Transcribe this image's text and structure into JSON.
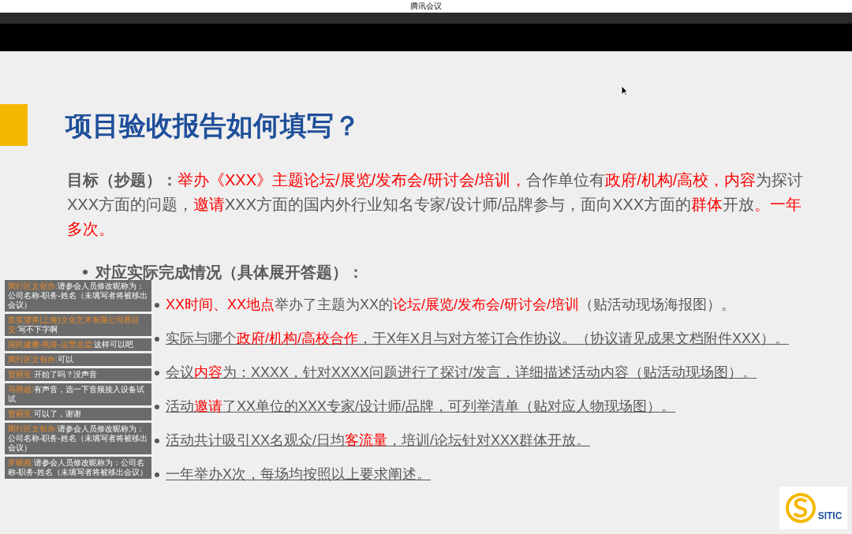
{
  "window": {
    "title": "腾讯会议"
  },
  "slide": {
    "title": "项目验收报告如何填写？",
    "goal": [
      {
        "text": "目标（抄题）：",
        "emphasis": false,
        "bold": true
      },
      {
        "text": "举办《XXX》主题论坛/展览/发布会/研讨会/培训，",
        "emphasis": true,
        "bold": false
      },
      {
        "text": "合作单位有",
        "emphasis": false,
        "bold": false
      },
      {
        "text": "政府/机构/高校，内容",
        "emphasis": true,
        "bold": false
      },
      {
        "text": "为探讨XXX方面的问题，",
        "emphasis": false,
        "bold": false
      },
      {
        "text": "邀请",
        "emphasis": true,
        "bold": false
      },
      {
        "text": "XXX方面的国内外行业知名专家/设计师/品牌参与，面向XXX方面的",
        "emphasis": false,
        "bold": false
      },
      {
        "text": "群体",
        "emphasis": true,
        "bold": false
      },
      {
        "text": "开放",
        "emphasis": false,
        "bold": false
      },
      {
        "text": "。一年多次。",
        "emphasis": true,
        "bold": false
      }
    ],
    "heading": "对应实际完成情况（具体展开答题）：",
    "bullets": [
      {
        "underlined": false,
        "parts": [
          {
            "text": "XX时间、XX地点",
            "emphasis": true
          },
          {
            "text": "举办了主题为XX的",
            "emphasis": false
          },
          {
            "text": "论坛/展览/发布会/研讨会/培训",
            "emphasis": true
          },
          {
            "text": "（贴活动现场海报图）。",
            "emphasis": false
          }
        ]
      },
      {
        "underlined": true,
        "parts": [
          {
            "text": "实际与哪个",
            "emphasis": false
          },
          {
            "text": "政府/机构/高校合作",
            "emphasis": true
          },
          {
            "text": "，于X年X月与对方签订合作协议。（协议请见成果文档附件XXX）。",
            "emphasis": false
          }
        ]
      },
      {
        "underlined": true,
        "parts": [
          {
            "text": "会议",
            "emphasis": false
          },
          {
            "text": "内容",
            "emphasis": true
          },
          {
            "text": "为：XXXX，针对XXXX问题进行了探讨/发言，详细描述活动内容（贴活动现场图）。",
            "emphasis": false
          }
        ]
      },
      {
        "underlined": true,
        "parts": [
          {
            "text": "活动",
            "emphasis": false
          },
          {
            "text": "邀请",
            "emphasis": true
          },
          {
            "text": "了XX单位的XXX专家/设计师/品牌，可列举清单（贴对应人物现场图）。",
            "emphasis": false
          }
        ]
      },
      {
        "underlined": true,
        "parts": [
          {
            "text": "活动共计吸引XX名观众/日均",
            "emphasis": false
          },
          {
            "text": "客流量",
            "emphasis": true
          },
          {
            "text": "，培训/论坛针对XXX群体开放。",
            "emphasis": false
          }
        ]
      },
      {
        "underlined": true,
        "parts": [
          {
            "text": "一年举办X次，每场均按照以上要求阐述。",
            "emphasis": false
          }
        ]
      }
    ],
    "logo_text": "SITIC"
  },
  "chat": [
    {
      "sender": "闵行区文创办:",
      "text": "请参会人员修改昵称为：公司名称-职务-姓名（未填写者将被移出会议）"
    },
    {
      "sender": "良笑望美(上海)文化艺术有限公司蔡目交:",
      "text": "写不下字啊"
    },
    {
      "sender": "国民健康-燕涛-运营总监:",
      "text": "这样可以吧"
    },
    {
      "sender": "闵行区文创办:",
      "text": "可以"
    },
    {
      "sender": "贾丽亚:",
      "text": "开始了吗？没声音"
    },
    {
      "sender": "马骋超:",
      "text": "有声音，选一下音频接入设备试试"
    },
    {
      "sender": "贾丽亚:",
      "text": "可以了，谢谢"
    },
    {
      "sender": "闵行区文创办:",
      "text": "请参会人员修改昵称为：公司名称-职务-姓名（未填写者将被移出会议）"
    },
    {
      "sender": "罗晓燕:",
      "text": "请参会人员修改昵称为：公司名称-职务-姓名（未填写者将被移出会议）"
    }
  ]
}
